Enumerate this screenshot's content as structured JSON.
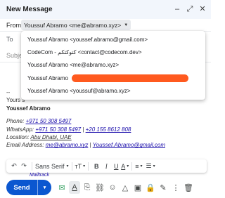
{
  "window": {
    "title": "New Message",
    "controls": {
      "minimize": "–",
      "expand": "⤢",
      "close": "✕"
    }
  },
  "from": {
    "label": "From",
    "value": "Youssuf Abramo <me@abramo.xyz>"
  },
  "to": {
    "label": "To"
  },
  "subject": {
    "placeholder": "Subje"
  },
  "from_options": [
    {
      "label": "Youssuf Abramo <youssef.abramo@gmail.com>",
      "redacted": false
    },
    {
      "label": "CodeCom - كتوكتكم <contact@codecom.dev>",
      "redacted": false
    },
    {
      "label": "Youssuf Abramo <me@abramo.xyz>",
      "redacted": false
    },
    {
      "label": "Youssuf Abramo",
      "redacted": true
    },
    {
      "label": "Youssef Abramo <youssuf@abramo.xyz>",
      "redacted": false
    }
  ],
  "body": {
    "dashes": "--",
    "closing": "Yours s",
    "signature_name": "Youssef Abramo",
    "phone_label": "Phone: ",
    "phone": "+971 50 308 5497",
    "whatsapp_label": "WhatsApp: ",
    "whatsapp_1": "+971 50 308 5497",
    "separator": " | ",
    "whatsapp_2": "+20 155 8612 808",
    "location_label": "Location: ",
    "location": "Abu Dhabi, UAE",
    "email_label": "Email Address: ",
    "email_1": "me@abramo.xyz",
    "email_sep": " | ",
    "email_2": "Youssef.Abramo@gmail.com",
    "peek_text": "Mailtrack"
  },
  "format_bar": {
    "undo": "↶",
    "redo": "↷",
    "font": "Sans Serif",
    "font_caret": "▾",
    "size": "тT",
    "size_caret": "▾",
    "bold": "B",
    "italic": "I",
    "underline": "U",
    "text_color": "A",
    "text_color_caret": "▾",
    "align": "≡",
    "align_caret": "▾",
    "list": "☰",
    "list_caret": "▾"
  },
  "send_bar": {
    "send_label": "Send",
    "send_caret": "▾",
    "tools": [
      {
        "name": "mailtrack-icon",
        "glyph": "✉"
      },
      {
        "name": "formatting-icon",
        "glyph": "A"
      },
      {
        "name": "attach-icon",
        "glyph": "⎘"
      },
      {
        "name": "link-icon",
        "glyph": "⛓"
      },
      {
        "name": "emoji-icon",
        "glyph": "☺"
      },
      {
        "name": "drive-icon",
        "glyph": "△"
      },
      {
        "name": "photo-icon",
        "glyph": "▣"
      },
      {
        "name": "lock-icon",
        "glyph": "🔒"
      },
      {
        "name": "signature-icon",
        "glyph": "✎"
      },
      {
        "name": "more-options-icon",
        "glyph": "⋮"
      },
      {
        "name": "delete-icon",
        "glyph": "🗑"
      }
    ]
  },
  "colors": {
    "accent": "#0b57d0",
    "redaction": "#ff5a1f",
    "titlebar": "#f2f6fc"
  }
}
